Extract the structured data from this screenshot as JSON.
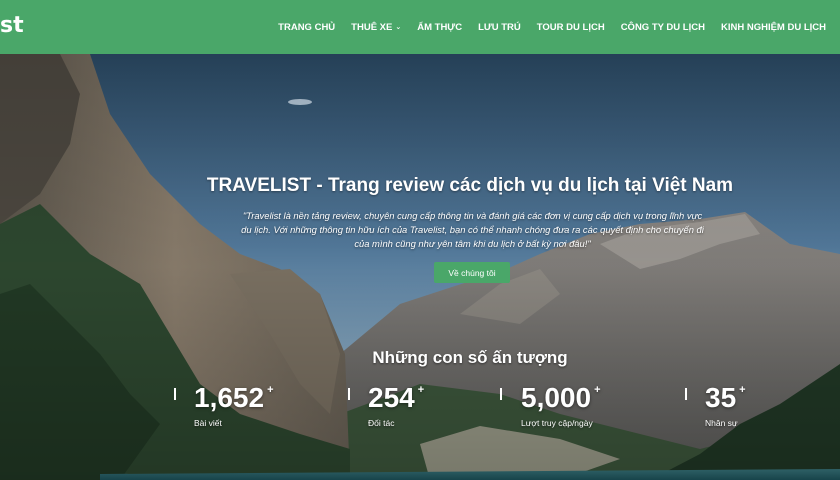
{
  "header": {
    "logo_text": "st",
    "nav": [
      {
        "label": "TRANG CHỦ",
        "has_dropdown": false
      },
      {
        "label": "THUÊ XE",
        "has_dropdown": true
      },
      {
        "label": "ẨM THỰC",
        "has_dropdown": false
      },
      {
        "label": "LƯU TRÚ",
        "has_dropdown": false
      },
      {
        "label": "TOUR DU LỊCH",
        "has_dropdown": false
      },
      {
        "label": "CÔNG TY DU LỊCH",
        "has_dropdown": false
      },
      {
        "label": "KINH NGHIỆM DU LỊCH",
        "has_dropdown": false
      }
    ],
    "dropdown_icon": "chevron-down-icon"
  },
  "hero": {
    "title": "TRAVELIST - Trang review các dịch vụ du lịch tại Việt Nam",
    "description_lines": [
      "\"Travelist là nền tảng review, chuyên cung cấp thông tin và đánh giá các đơn vị cung cấp dịch vụ trong lĩnh vực",
      "du lịch. Với những thông tin hữu ích của Travelist, bạn có thể nhanh chóng đưa ra các quyết định cho chuyến đi",
      "của mình cũng như yên tâm khi du lịch ở bất kỳ nơi đâu!\""
    ],
    "button_label": "Về chúng tôi"
  },
  "stats": {
    "title": "Những con số ấn tượng",
    "items": [
      {
        "value": "1,652",
        "suffix": "+",
        "label": "Bài viết"
      },
      {
        "value": "254",
        "suffix": "+",
        "label": "Đối tác"
      },
      {
        "value": "5,000",
        "suffix": "+",
        "label": "Lượt truy cập/ngày"
      },
      {
        "value": "35",
        "suffix": "+",
        "label": "Nhân sự"
      }
    ]
  },
  "colors": {
    "brand_green": "#4aa769",
    "text_white": "#ffffff"
  }
}
